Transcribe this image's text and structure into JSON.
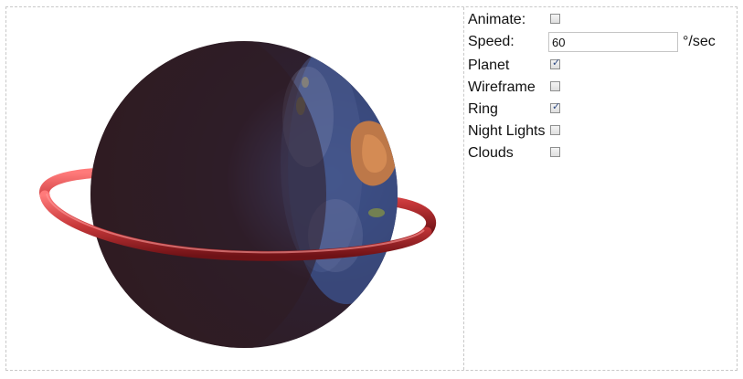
{
  "controls": {
    "animate": {
      "label": "Animate:",
      "checked": false
    },
    "speed": {
      "label": "Speed:",
      "value": "60",
      "unit": "°/sec"
    },
    "planet": {
      "label": "Planet",
      "checked": true
    },
    "wireframe": {
      "label": "Wireframe",
      "checked": false
    },
    "ring": {
      "label": "Ring",
      "checked": true
    },
    "night_lights": {
      "label": "Night Lights",
      "checked": false
    },
    "clouds": {
      "label": "Clouds",
      "checked": false
    }
  },
  "colors": {
    "ring": "#c8383a",
    "planet_dark": "#2f1c22",
    "ocean": "#3a4f86",
    "land": "#c47a46"
  }
}
